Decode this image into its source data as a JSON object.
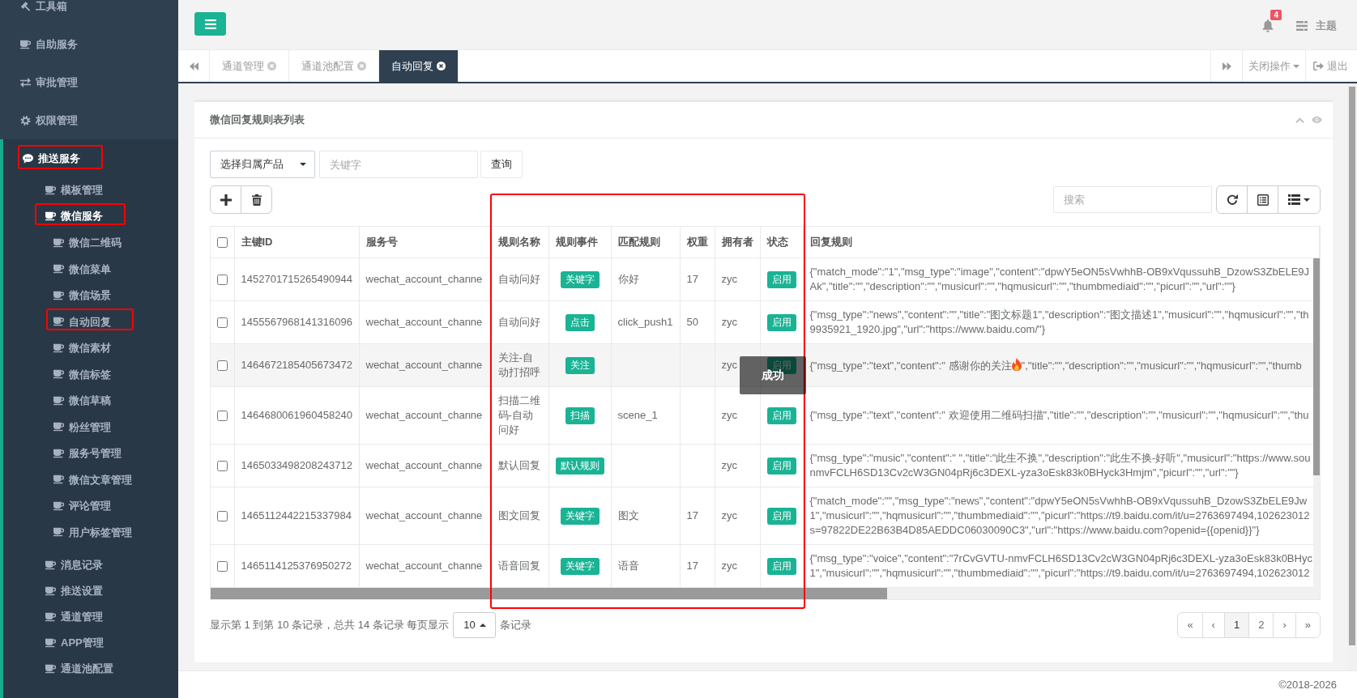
{
  "sidebar": {
    "items": [
      {
        "label": "工具箱",
        "active": false,
        "highlighted": false
      },
      {
        "label": "自助服务",
        "active": false,
        "highlighted": false
      },
      {
        "label": "审批管理",
        "active": false,
        "highlighted": false
      },
      {
        "label": "权限管理",
        "active": false,
        "highlighted": false
      },
      {
        "label": "推送服务",
        "active": true,
        "highlighted": true,
        "children": [
          {
            "label": "模板管理",
            "active": false,
            "highlighted": false
          },
          {
            "label": "微信服务",
            "active": true,
            "highlighted": true,
            "children": [
              {
                "label": "微信二维码",
                "highlighted": false
              },
              {
                "label": "微信菜单",
                "highlighted": false
              },
              {
                "label": "微信场景",
                "highlighted": false
              },
              {
                "label": "自动回复",
                "highlighted": true
              },
              {
                "label": "微信素材",
                "highlighted": false
              },
              {
                "label": "微信标签",
                "highlighted": false
              },
              {
                "label": "微信草稿",
                "highlighted": false
              },
              {
                "label": "粉丝管理",
                "highlighted": false
              },
              {
                "label": "服务号管理",
                "highlighted": false
              },
              {
                "label": "微信文章管理",
                "highlighted": false
              },
              {
                "label": "评论管理",
                "highlighted": false
              },
              {
                "label": "用户标签管理",
                "highlighted": false
              }
            ]
          },
          {
            "label": "消息记录",
            "active": false,
            "highlighted": false
          },
          {
            "label": "推送设置",
            "active": false,
            "highlighted": false
          },
          {
            "label": "通道管理",
            "active": false,
            "highlighted": false
          },
          {
            "label": "APP管理",
            "active": false,
            "highlighted": false
          },
          {
            "label": "通道池配置",
            "active": false,
            "highlighted": false
          }
        ]
      }
    ]
  },
  "top_bar": {
    "notification_count": "4",
    "theme_label": "主题"
  },
  "tab_bar": {
    "tabs": [
      {
        "label": "通道管理",
        "selected": false
      },
      {
        "label": "通道池配置",
        "selected": false
      },
      {
        "label": "自动回复",
        "selected": true
      }
    ],
    "close_menu": "关闭操作",
    "logout": "退出"
  },
  "panel": {
    "title": "微信回复规则表列表",
    "filter": {
      "product_select": {
        "value": "选择归属产品"
      },
      "keyword": {
        "placeholder": "关键字"
      },
      "query_button": "查询"
    },
    "search": {
      "placeholder": "搜索"
    },
    "table": {
      "select_all_checked": false,
      "columns": [
        {
          "label": "主键ID",
          "highlighted": false
        },
        {
          "label": "服务号",
          "highlighted": false
        },
        {
          "label": "规则名称",
          "highlighted": true
        },
        {
          "label": "规则事件",
          "highlighted": true
        },
        {
          "label": "匹配规则",
          "highlighted": true
        },
        {
          "label": "权重",
          "highlighted": true
        },
        {
          "label": "拥有者",
          "highlighted": true
        },
        {
          "label": "状态",
          "highlighted": true
        },
        {
          "label": "回复规则",
          "highlighted": false
        }
      ],
      "rows": [
        {
          "checked": false,
          "hovered": false,
          "id": "1452701715265490944",
          "service_account": "wechat_account_channe",
          "rule_name": "自动问好",
          "event": "关键字",
          "match_rule": "你好",
          "weight": "17",
          "owner": "zyc",
          "status": "启用",
          "reply_rule": [
            "{\"match_mode\":\"1\",\"msg_type\":\"image\",\"content\":\"dpwY5eON5sVwhhB-OB9xVqussuhB_DzowS3ZbELE9J",
            "Ak\",\"title\":\"\",\"description\":\"\",\"musicurl\":\"\",\"hqmusicurl\":\"\",\"thumbmediaid\":\"\",\"picurl\":\"\",\"url\":\"\"}"
          ]
        },
        {
          "checked": false,
          "hovered": false,
          "id": "1455567968141316096",
          "service_account": "wechat_account_channe",
          "rule_name": "自动问好",
          "event": "点击",
          "match_rule": "click_push1",
          "weight": "50",
          "owner": "zyc",
          "status": "启用",
          "reply_rule": [
            "{\"msg_type\":\"news\",\"content\":\"\",\"title\":\"图文标题1\",\"description\":\"图文描述1\",\"musicurl\":\"\",\"hqmusicurl\":\"\",\"th",
            "9935921_1920.jpg\",\"url\":\"https://www.baidu.com/\"}"
          ]
        },
        {
          "checked": false,
          "hovered": true,
          "id": "1464672185405673472",
          "service_account": "wechat_account_channe",
          "rule_name": "关注-自动打招呼",
          "event": "关注",
          "owner": "zyc",
          "status": "启用",
          "reply_rule": [
            [
              "{\"msg_type\":\"text\",\"content\":\" 感谢你的关注",
              {
                "kind": "emoji"
              },
              "\",\"title\":\"\",\"description\":\"\",\"musicurl\":\"\",\"hqmusicurl\":\"\",\"thumb"
            ]
          ]
        },
        {
          "checked": false,
          "hovered": false,
          "id": "1464680061960458240",
          "service_account": "wechat_account_channe",
          "rule_name": "扫描二维码-自动问好",
          "event": "扫描",
          "match_rule": "scene_1",
          "owner": "zyc",
          "status": "启用",
          "reply_rule": [
            "{\"msg_type\":\"text\",\"content\":\" 欢迎使用二维码扫描\",\"title\":\"\",\"description\":\"\",\"musicurl\":\"\",\"hqmusicurl\":\"\",\"thu"
          ]
        },
        {
          "checked": false,
          "hovered": false,
          "id": "1465033498208243712",
          "service_account": "wechat_account_channe",
          "rule_name": "默认回复",
          "event": "默认规则",
          "owner": "zyc",
          "status": "启用",
          "reply_rule": [
            "{\"msg_type\":\"music\",\"content\":\" \",\"title\":\"此生不换\",\"description\":\"此生不换-好听\",\"musicurl\":\"https://www.sou",
            "nmvFCLH6SD13Cv2cW3GN04pRj6c3DEXL-yza3oEsk83k0BHyck3Hmjm\",\"picurl\":\"\",\"url\":\"\"}"
          ]
        },
        {
          "checked": false,
          "hovered": false,
          "id": "1465112442215337984",
          "service_account": "wechat_account_channe",
          "rule_name": "图文回复",
          "event": "关键字",
          "match_rule": "图文",
          "weight": "17",
          "owner": "zyc",
          "status": "启用",
          "reply_rule": [
            "{\"match_mode\":\"\",\"msg_type\":\"news\",\"content\":\"dpwY5eON5sVwhhB-OB9xVqussuhB_DzowS3ZbELE9Jw",
            "1\",\"musicurl\":\"\",\"hqmusicurl\":\"\",\"thumbmediaid\":\"\",\"picurl\":\"https://t9.baidu.com/it/u=2763697494,102623012",
            "s=97822DE22B63B4D85AEDDC06030090C3\",\"url\":\"https://www.baidu.com?openid={{openid}}\"}"
          ]
        },
        {
          "checked": false,
          "hovered": false,
          "id": "1465114125376950272",
          "service_account": "wechat_account_channe",
          "rule_name": "语音回复",
          "event": "关键字",
          "match_rule": "语音",
          "weight": "17",
          "owner": "zyc",
          "status": "启用",
          "reply_rule": [
            "{\"msg_type\":\"voice\",\"content\":\"7rCvGVTU-nmvFCLH6SD13Cv2cW3GN04pRj6c3DEXL-yza3oEsk83k0BHyc",
            "1\",\"musicurl\":\"\",\"hqmusicurl\":\"\",\"thumbmediaid\":\"\",\"picurl\":\"https://t9.baidu.com/it/u=2763697494,102623012"
          ]
        }
      ]
    },
    "pagination": {
      "summary": "显示第 1 到第 10 条记录，总共 14 条记录 每页显示",
      "page_size": "10",
      "summary_suffix": "条记录",
      "pages": [
        {
          "label": "«",
          "selected": false
        },
        {
          "label": "‹",
          "selected": false
        },
        {
          "label": "1",
          "selected": true
        },
        {
          "label": "2",
          "selected": false
        },
        {
          "label": "›",
          "selected": false
        },
        {
          "label": "»",
          "selected": false
        }
      ]
    }
  },
  "toast": {
    "text": "成功"
  },
  "footer": {
    "copyright": "©2018-2026"
  }
}
